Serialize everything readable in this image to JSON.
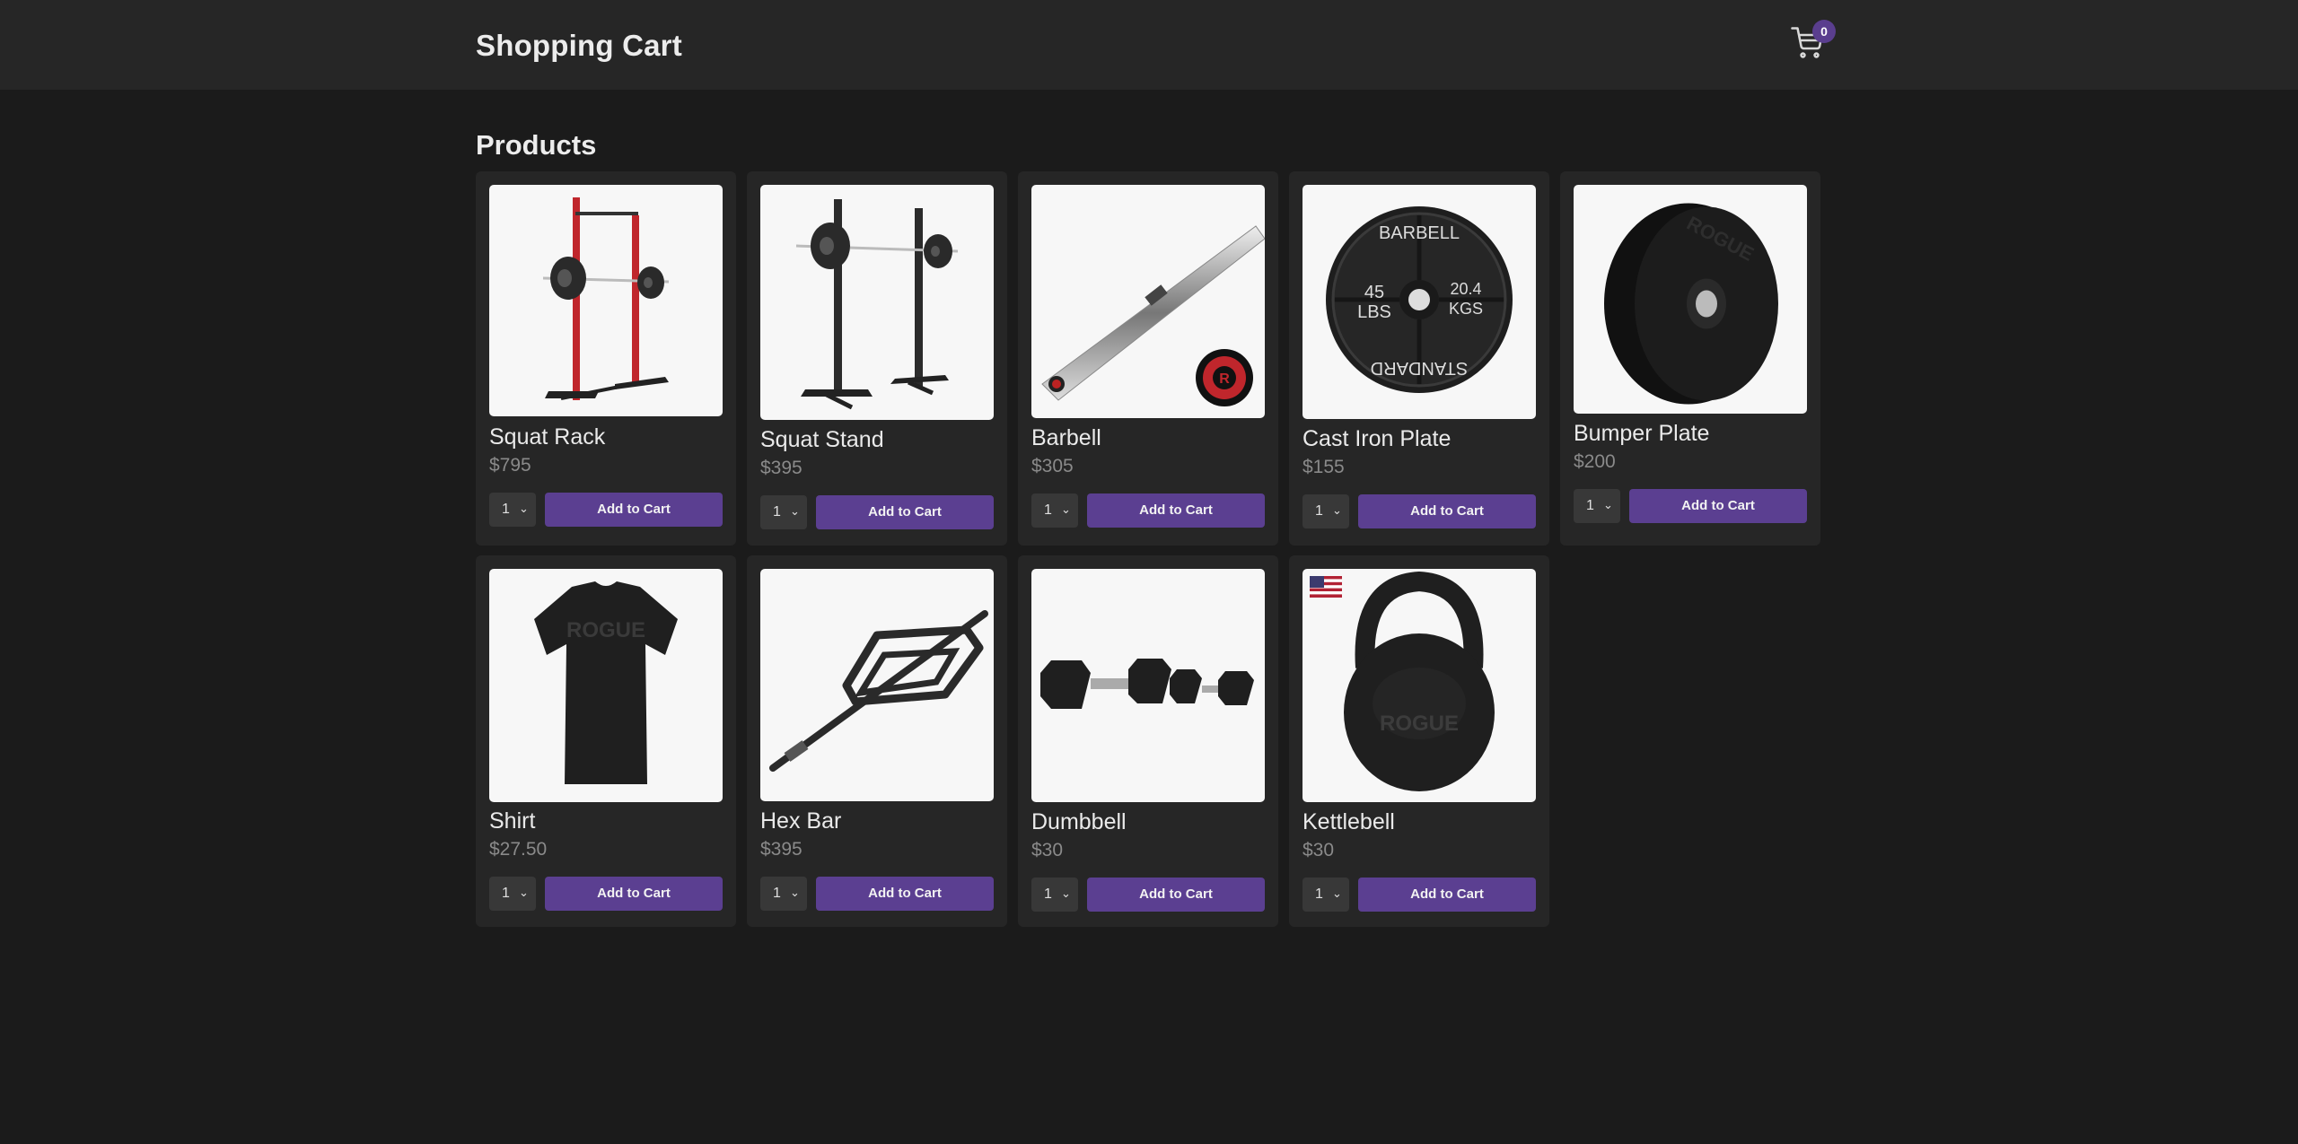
{
  "header": {
    "title": "Shopping Cart",
    "cart_count": "0",
    "cart_icon": "cart-icon"
  },
  "products_section": {
    "title": "Products"
  },
  "accent_color": "#5b3f91",
  "products": [
    {
      "name": "Squat Rack",
      "price": "$795",
      "qty": "1",
      "button": "Add to Cart",
      "image": "squat-rack-image"
    },
    {
      "name": "Squat Stand",
      "price": "$395",
      "qty": "1",
      "button": "Add to Cart",
      "image": "squat-stand-image"
    },
    {
      "name": "Barbell",
      "price": "$305",
      "qty": "1",
      "button": "Add to Cart",
      "image": "barbell-image"
    },
    {
      "name": "Cast Iron Plate",
      "price": "$155",
      "qty": "1",
      "button": "Add to Cart",
      "image": "cast-iron-plate-image",
      "plate_text": {
        "top": "BARBELL",
        "bottom": "STANDARD",
        "left_line1": "45",
        "left_line2": "LBS",
        "right_line1": "20.4",
        "right_line2": "KGS"
      }
    },
    {
      "name": "Bumper Plate",
      "price": "$200",
      "qty": "1",
      "button": "Add to Cart",
      "image": "bumper-plate-image",
      "plate_text": {
        "brand": "ROGUE"
      }
    },
    {
      "name": "Shirt",
      "price": "$27.50",
      "qty": "1",
      "button": "Add to Cart",
      "image": "shirt-image",
      "plate_text": {
        "brand": "ROGUE"
      }
    },
    {
      "name": "Hex Bar",
      "price": "$395",
      "qty": "1",
      "button": "Add to Cart",
      "image": "hex-bar-image"
    },
    {
      "name": "Dumbbell",
      "price": "$30",
      "qty": "1",
      "button": "Add to Cart",
      "image": "dumbbell-image"
    },
    {
      "name": "Kettlebell",
      "price": "$30",
      "qty": "1",
      "button": "Add to Cart",
      "image": "kettlebell-image",
      "plate_text": {
        "brand": "ROGUE"
      }
    }
  ]
}
